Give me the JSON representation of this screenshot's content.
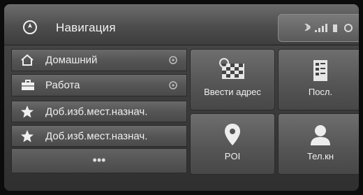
{
  "header": {
    "title": "Навигация",
    "icon": "compass-home-icon"
  },
  "status_bar": {
    "icons": [
      "bluetooth-icon",
      "signal-strength-icon",
      "battery-icon",
      "settings-icon"
    ]
  },
  "list": [
    {
      "label": "Домашний",
      "icon": "house-icon",
      "has_option": true
    },
    {
      "label": "Работа",
      "icon": "briefcase-icon",
      "has_option": true
    },
    {
      "label": "Доб.изб.мест.назнач.",
      "icon": "star-icon",
      "has_option": false
    },
    {
      "label": "Доб.изб.мест.назнач.",
      "icon": "star-icon",
      "has_option": false
    }
  ],
  "more_label": "•••",
  "tiles": [
    {
      "label": "Ввести адрес",
      "icon": "map-address-icon"
    },
    {
      "label": "Посл.",
      "icon": "recent-list-icon"
    },
    {
      "label": "POI",
      "icon": "map-pin-icon"
    },
    {
      "label": "Тел.кн",
      "icon": "contact-person-icon"
    }
  ],
  "colors": {
    "panel": "#4a4a4a",
    "header": "#6c6c6c",
    "text": "#f0f0f0"
  }
}
